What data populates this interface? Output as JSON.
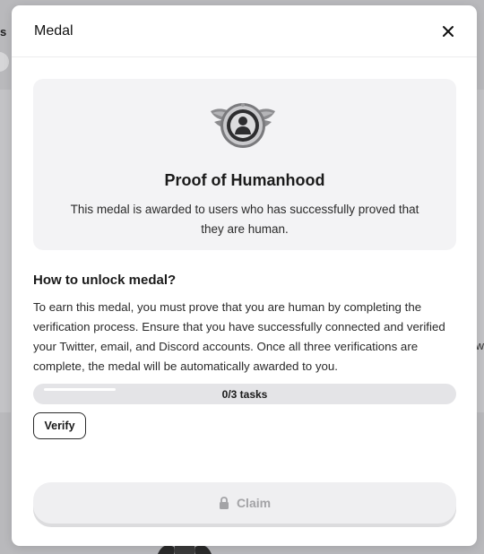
{
  "background": {
    "left_fragment_text": "s",
    "right_fragment_text": "w"
  },
  "modal": {
    "title": "Medal",
    "close_icon": "close-icon"
  },
  "medal": {
    "icon": "winged-medal-icon",
    "name": "Proof of Humanhood",
    "description": "This medal is awarded to users who has successfully proved that they are human."
  },
  "unlock": {
    "heading": "How to unlock medal?",
    "instructions": "To earn this medal, you must prove that you are human by completing the verification process. Ensure that you have successfully connected and verified your Twitter, email, and Discord accounts. Once all three verifications are complete, the medal will be automatically awarded to you."
  },
  "progress": {
    "completed": 0,
    "total": 3,
    "label": "0/3 tasks"
  },
  "actions": {
    "verify_label": "Verify",
    "claim_label": "Claim",
    "claim_icon": "lock-icon"
  },
  "colors": {
    "overlay": "#b9b9bc",
    "card_bg": "#f3f3f5",
    "progress_track": "#e4e4e7",
    "claim_disabled_text": "#a3a3a6"
  }
}
